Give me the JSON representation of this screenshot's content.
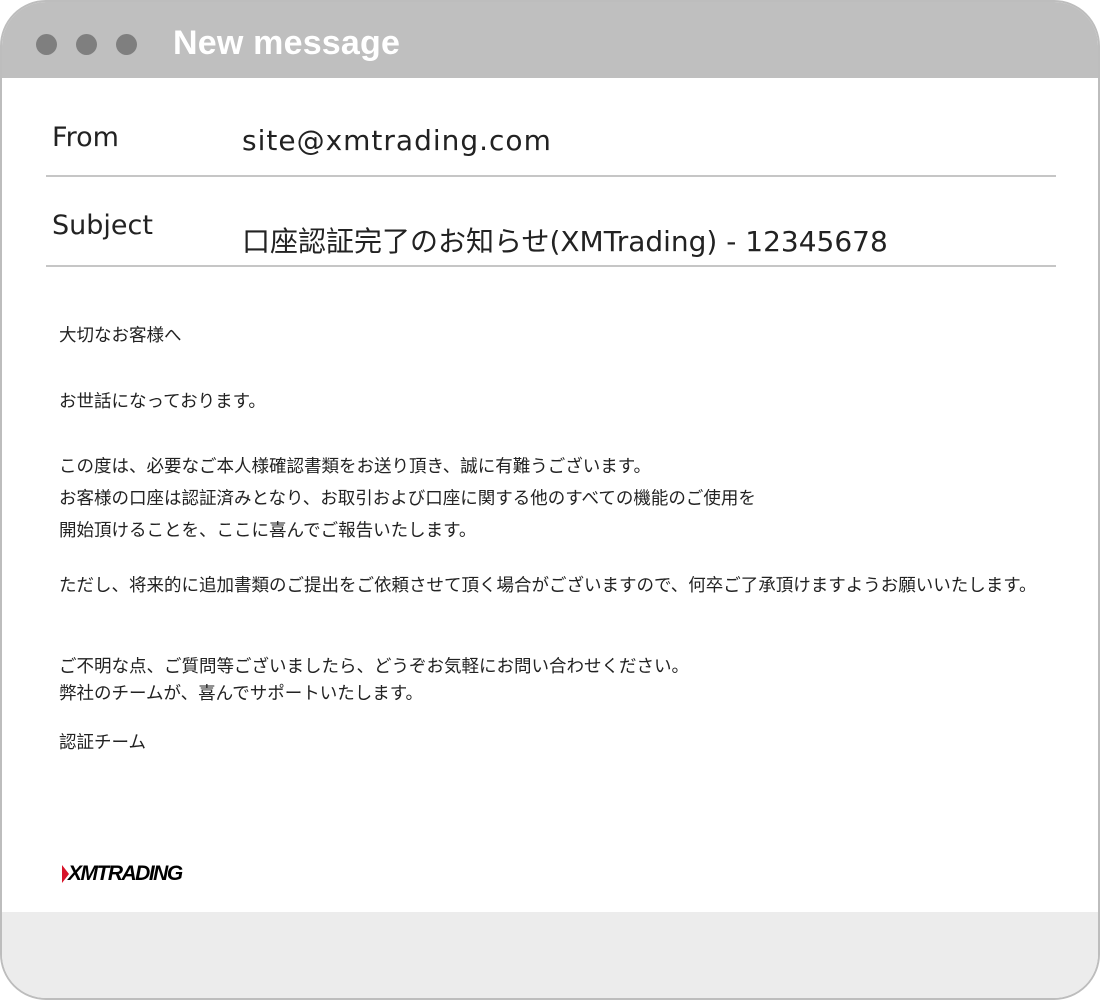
{
  "window": {
    "title": "New message"
  },
  "fields": {
    "from_label": "From",
    "from_value": "site@xmtrading.com",
    "subject_label": "Subject",
    "subject_value": "口座認証完了のお知らせ(XMTrading) - 12345678"
  },
  "body": {
    "greeting": "大切なお客様へ",
    "intro": "お世話になっております。",
    "para1_line1": "この度は、必要なご本人様確認書類をお送り頂き、誠に有難うございます。",
    "para1_line2": "お客様の口座は認証済みとなり、お取引および口座に関する他のすべての機能のご使用を",
    "para1_line3": "開始頂けることを、ここに喜んでご報告いたします。",
    "para2": "ただし、将来的に追加書類のご提出をご依頼させて頂く場合がございますので、何卒ご了承頂けますようお願いいたします。",
    "para3_line1": "ご不明な点、ご質問等ございましたら、どうぞお気軽にお問い合わせください。",
    "para3_line2": "弊社のチームが、喜んでサポートいたします。",
    "signature": "認証チーム"
  },
  "logo": {
    "text": "XMTRADING",
    "accent_color": "#d7142a"
  },
  "colors": {
    "titlebar": "#bfbfbf",
    "window_dot": "#7f7f7f",
    "footer": "#ececec",
    "divider": "#c6c6c6"
  }
}
